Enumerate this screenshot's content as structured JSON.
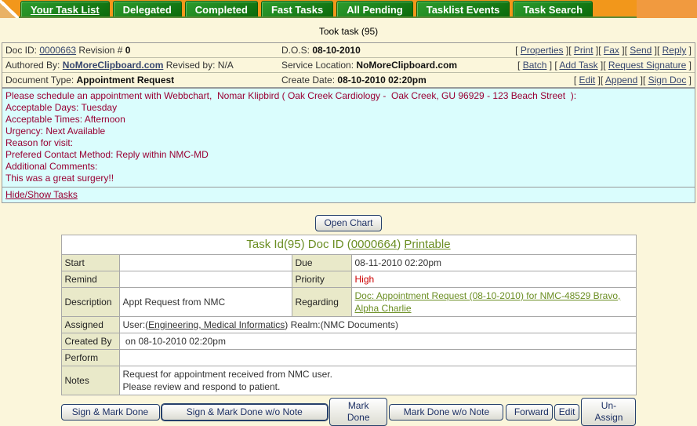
{
  "tabs": [
    {
      "label": "Your Task List",
      "active": true
    },
    {
      "label": "Delegated",
      "active": false
    },
    {
      "label": "Completed",
      "active": false
    },
    {
      "label": "Fast Tasks",
      "active": false
    },
    {
      "label": "All Pending",
      "active": false
    },
    {
      "label": "Tasklist Events",
      "active": false
    },
    {
      "label": "Task Search",
      "active": false
    }
  ],
  "page_title": "Took task (95)",
  "doc_info": {
    "doc_id_label": "Doc ID:",
    "doc_id": "0000663",
    "revision_label": "Revision #",
    "revision": "0",
    "authored_by_label": "Authored By:",
    "authored_by": "NoMoreClipboard.com",
    "revised_by_label": "Revised by:",
    "revised_by": "N/A",
    "document_type_label": "Document Type:",
    "document_type": "Appointment Request",
    "dos_label": "D.O.S:",
    "dos": "08-10-2010",
    "service_location_label": "Service Location:",
    "service_location": "NoMoreClipboard.com",
    "create_date_label": "Create Date:",
    "create_date": "08-10-2010 02:20pm",
    "actions_row1": [
      "Properties",
      "Print",
      "Fax",
      "Send",
      "Reply"
    ],
    "actions_row2": [
      "Batch",
      "Add Task",
      "Request Signature"
    ],
    "actions_row3": [
      "Edit",
      "Append",
      "Sign Doc"
    ]
  },
  "message": {
    "lines": [
      "Please schedule an appointment with Webbchart,  Nomar Klipbird ( Oak Creek Cardiology -  Oak Creek, GU 96929 - 123 Beach Street  ):",
      "Acceptable Days: Tuesday",
      "Acceptable Times: Afternoon",
      "Urgency: Next Available",
      "Reason for visit:",
      "Prefered Contact Method: Reply within NMC-MD",
      "Additional Comments:",
      "This was a great surgery!!"
    ],
    "hide_show_link": "Hide/Show Tasks"
  },
  "open_chart_label": "Open Chart",
  "task_table": {
    "header_prefix": "Task Id(95) Doc ID (",
    "header_doc_link": "0000664",
    "header_close": ") ",
    "header_printable_link": "Printable",
    "start_label": "Start",
    "start_value": "",
    "due_label": "Due",
    "due_value": "08-11-2010 02:20pm",
    "remind_label": "Remind",
    "remind_value": "",
    "priority_label": "Priority",
    "priority_value": "High",
    "description_label": "Description",
    "description_value": "Appt Request from NMC",
    "regarding_label": "Regarding",
    "regarding_link": "Doc: Appointment Request (08-10-2010) for NMC-48529 Bravo, Alpha Charlie",
    "assigned_label": "Assigned",
    "assigned_prefix": "User:(",
    "assigned_user_link": "Engineering, Medical Informatics",
    "assigned_suffix": ") Realm:(NMC Documents)",
    "created_by_label": "Created By",
    "created_by_value": " on 08-10-2010 02:20pm",
    "perform_label": "Perform",
    "perform_value": "",
    "notes_label": "Notes",
    "notes_line1": "Request for appointment received from NMC user.",
    "notes_line2": "Please review and respond to patient."
  },
  "footer_buttons": [
    "Sign & Mark Done",
    "Sign & Mark Done w/o Note",
    "Mark Done",
    "Mark Done w/o Note",
    "Forward",
    "Edit",
    "Un-Assign"
  ],
  "colors": {
    "tab_bar_orange": "#F2971B",
    "tab_green": "#1E7E1E",
    "page_background": "#FBF6DB",
    "message_background": "#DAFDFD",
    "message_text_maroon": "#990033",
    "olive_green_link": "#6B8E23",
    "priority_red": "#CC0000",
    "label_cell_khaki": "#E9E9C9"
  }
}
